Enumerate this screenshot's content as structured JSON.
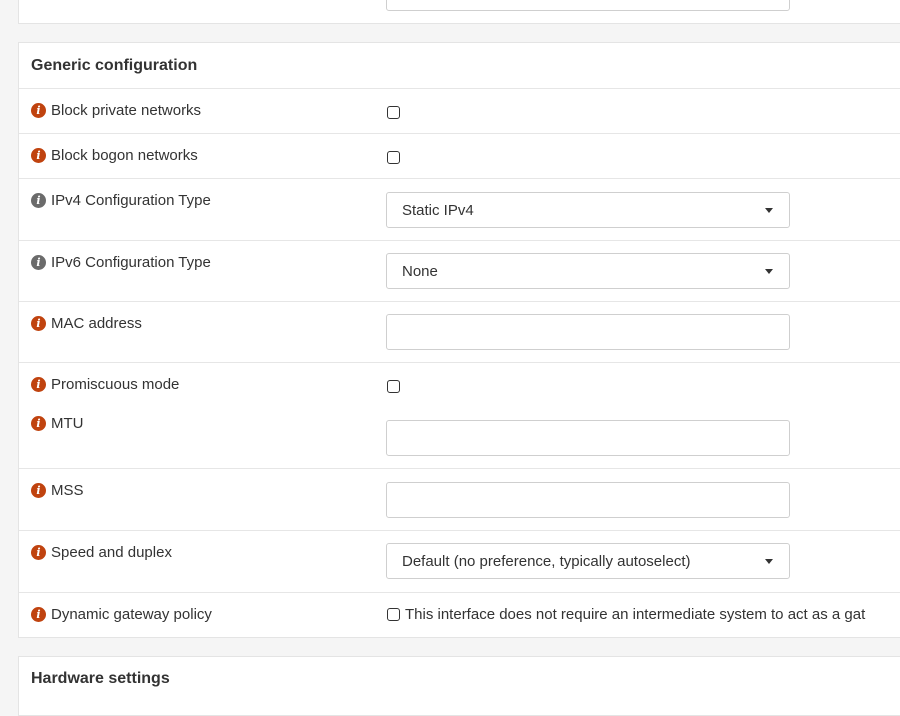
{
  "generic_section": {
    "title": "Generic configuration",
    "block_private": {
      "label": "Block private networks",
      "checked": false
    },
    "block_bogon": {
      "label": "Block bogon networks",
      "checked": false
    },
    "ipv4_type": {
      "label": "IPv4 Configuration Type",
      "value": "Static IPv4"
    },
    "ipv6_type": {
      "label": "IPv6 Configuration Type",
      "value": "None"
    },
    "mac_address": {
      "label": "MAC address",
      "value": ""
    },
    "promiscuous": {
      "label": "Promiscuous mode",
      "checked": false
    },
    "mtu": {
      "label": "MTU",
      "value": ""
    },
    "mss": {
      "label": "MSS",
      "value": ""
    },
    "speed_duplex": {
      "label": "Speed and duplex",
      "value": "Default (no preference, typically autoselect)"
    },
    "dynamic_gateway": {
      "label": "Dynamic gateway policy",
      "checked": false,
      "option_text": "This interface does not require an intermediate system to act as a gat"
    }
  },
  "hardware_section": {
    "title": "Hardware settings"
  },
  "colors": {
    "info_orange": "#c0430f",
    "info_gray": "#6b6b6b"
  }
}
